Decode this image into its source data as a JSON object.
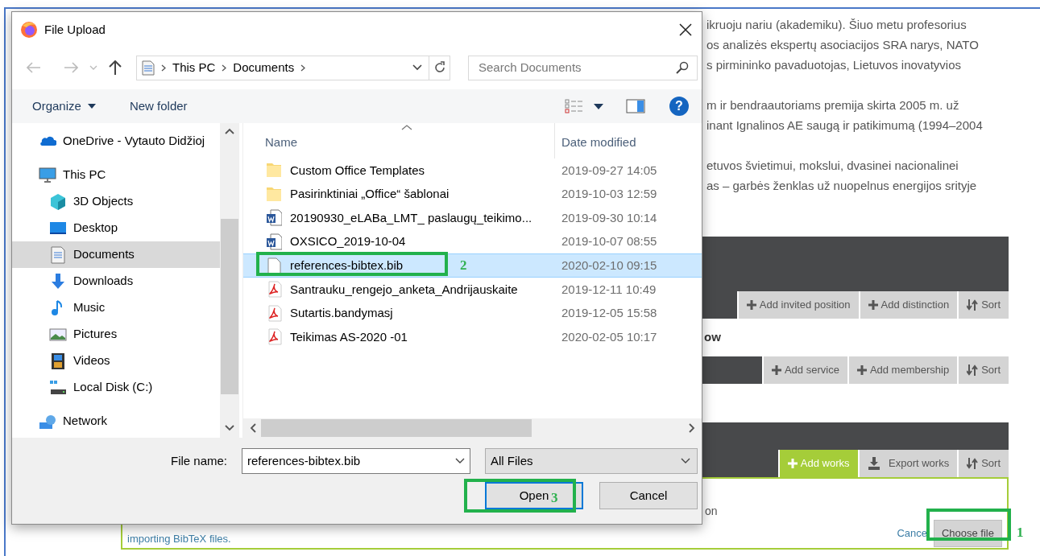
{
  "page": {
    "paragraphs": [
      [
        "ikruoju nariu (akademiku). Šiuo metu profesorius",
        "os analizės ekspertų asociacijos SRA narys, NATO",
        "s pirmininko pavaduotojas, Lietuvos inovatyvios"
      ],
      [
        "m ir bendraautoriams premija skirta 2005 m. už",
        "inant Ignalinos AE saugą ir patikimumą (1994–2004"
      ],
      [
        "etuvos švietimui, mokslui, dvasinei nacionalinei",
        "as – garbės ženklas už nuopelnus energijos srityje"
      ]
    ],
    "sections": [
      {
        "top_bar": true,
        "buttons": [
          {
            "kind": "add",
            "label": "Add invited position",
            "selected": false
          },
          {
            "kind": "add",
            "label": "Add distinction",
            "selected": false
          },
          {
            "kind": "sort",
            "label": "Sort",
            "selected": false
          }
        ]
      },
      {
        "heading": "ow",
        "top_bar": false,
        "buttons": [
          {
            "kind": "add",
            "label": "Add service",
            "selected": false
          },
          {
            "kind": "add",
            "label": "Add membership",
            "selected": false
          },
          {
            "kind": "sort",
            "label": "Sort",
            "selected": false
          }
        ]
      },
      {
        "top_bar": true,
        "buttons": [
          {
            "kind": "add",
            "label": "Add works",
            "selected": true
          },
          {
            "kind": "export",
            "label": "Export works",
            "selected": false
          },
          {
            "kind": "sort",
            "label": "Sort",
            "selected": false
          }
        ]
      }
    ],
    "import_box": {
      "text": "on",
      "hint": "importing BibTeX files.",
      "cancel_link": "Cance",
      "choose_button": "Choose file"
    }
  },
  "dialog": {
    "title": "File Upload",
    "path": [
      "This PC",
      "Documents"
    ],
    "search": {
      "placeholder": "Search Documents"
    },
    "commands": [
      "Organize",
      "New folder"
    ],
    "help": "?",
    "nav": [
      {
        "kind": "cloud",
        "label": "OneDrive - Vytauto Didžioj",
        "selected": false
      },
      {
        "kind": "monitor",
        "label": "This PC",
        "selected": false,
        "children": [
          {
            "kind": "cube",
            "label": "3D Objects",
            "selected": false
          },
          {
            "kind": "desktop",
            "label": "Desktop",
            "selected": false
          },
          {
            "kind": "document",
            "label": "Documents",
            "selected": true
          },
          {
            "kind": "download",
            "label": "Downloads",
            "selected": false
          },
          {
            "kind": "music",
            "label": "Music",
            "selected": false
          },
          {
            "kind": "picture",
            "label": "Pictures",
            "selected": false
          },
          {
            "kind": "video",
            "label": "Videos",
            "selected": false
          },
          {
            "kind": "disk",
            "label": "Local Disk (C:)",
            "selected": false
          }
        ]
      },
      {
        "kind": "network",
        "label": "Network",
        "selected": false
      }
    ],
    "columns": [
      "Name",
      "Date modified"
    ],
    "files": [
      {
        "kind": "folder",
        "name": "Custom Office Templates",
        "date": "2019-09-27 14:05",
        "selected": false
      },
      {
        "kind": "folder",
        "name": "Pasirinktiniai „Office“ šablonai",
        "date": "2019-10-03 12:59",
        "selected": false
      },
      {
        "kind": "word",
        "name": "20190930_eLABa_LMT_ paslaugų_teikimo...",
        "date": "2019-09-30 10:14",
        "selected": false
      },
      {
        "kind": "word",
        "name": "OXSICO_2019-10-04",
        "date": "2019-10-07 08:55",
        "selected": false
      },
      {
        "kind": "file",
        "name": "references-bibtex.bib",
        "date": "2020-02-10 09:15",
        "selected": true
      },
      {
        "kind": "pdf",
        "name": "Santrauku_rengejo_anketa_Andrijauskaite",
        "date": "2019-12-11 10:49",
        "selected": false
      },
      {
        "kind": "pdf",
        "name": "Sutartis.bandymasj",
        "date": "2019-12-05 15:58",
        "selected": false
      },
      {
        "kind": "pdf",
        "name": "Teikimas AS-2020 -01",
        "date": "2020-02-05 10:17",
        "selected": false
      }
    ],
    "file_name": {
      "label": "File name:",
      "value": "references-bibtex.bib"
    },
    "file_type": "All Files",
    "buttons": [
      {
        "label": "Open",
        "default": true
      },
      {
        "label": "Cancel",
        "default": false
      }
    ]
  },
  "annotations": [
    {
      "label": "1"
    },
    {
      "label": "2"
    },
    {
      "label": "3"
    }
  ]
}
